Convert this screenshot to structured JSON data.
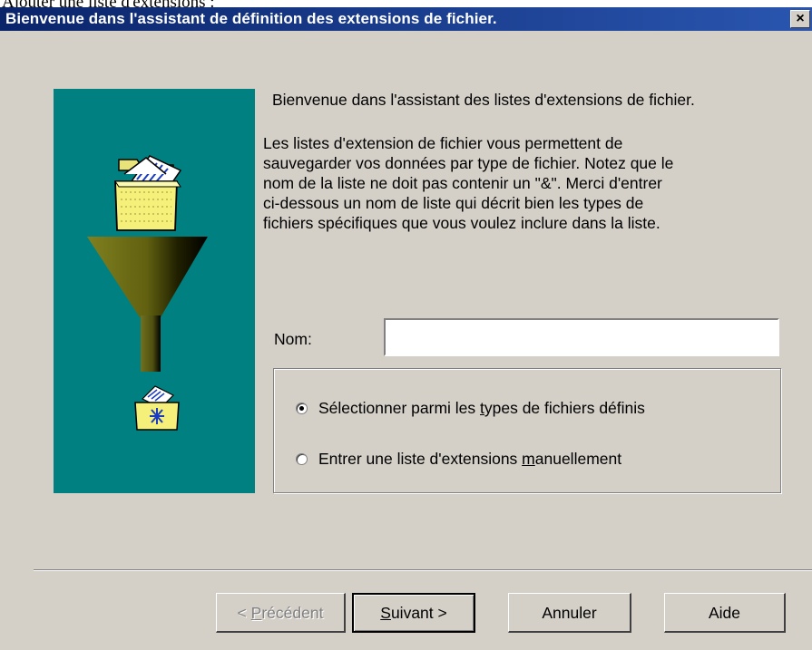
{
  "page_caption": "Ajouter une liste d'extensions :",
  "window": {
    "title": "Bienvenue dans l'assistant de définition des extensions de fichier.",
    "close_label": "×"
  },
  "panel": {
    "icons": [
      "folder-with-documents-icon",
      "funnel-icon",
      "folder-with-star-icon"
    ],
    "background_color": "#008080"
  },
  "content": {
    "intro": "Bienvenue dans l'assistant des listes d'extensions de fichier.",
    "description": "Les listes d'extension de fichier vous permettent de\nsauvegarder vos données par type de fichier. Notez que le\nnom de la liste ne doit pas contenir un \"&\".  Merci d'entrer\nci-dessous un nom de liste qui décrit bien les types de\nfichiers spécifiques que vous voulez inclure dans la liste."
  },
  "form": {
    "name_label": "Nom:",
    "name_value": "",
    "options": [
      {
        "label_pre": "Sélectionner parmi les ",
        "label_u": "t",
        "label_post": "ypes de fichiers définis",
        "checked": true
      },
      {
        "label_pre": "Entrer une liste d'extensions ",
        "label_u": "m",
        "label_post": "anuellement",
        "checked": false
      }
    ]
  },
  "buttons": {
    "back": {
      "pre": "< ",
      "u": "P",
      "post": "récédent",
      "enabled": false
    },
    "next": {
      "pre": "",
      "u": "S",
      "post": "uivant >",
      "enabled": true
    },
    "cancel": "Annuler",
    "help": "Aide"
  }
}
